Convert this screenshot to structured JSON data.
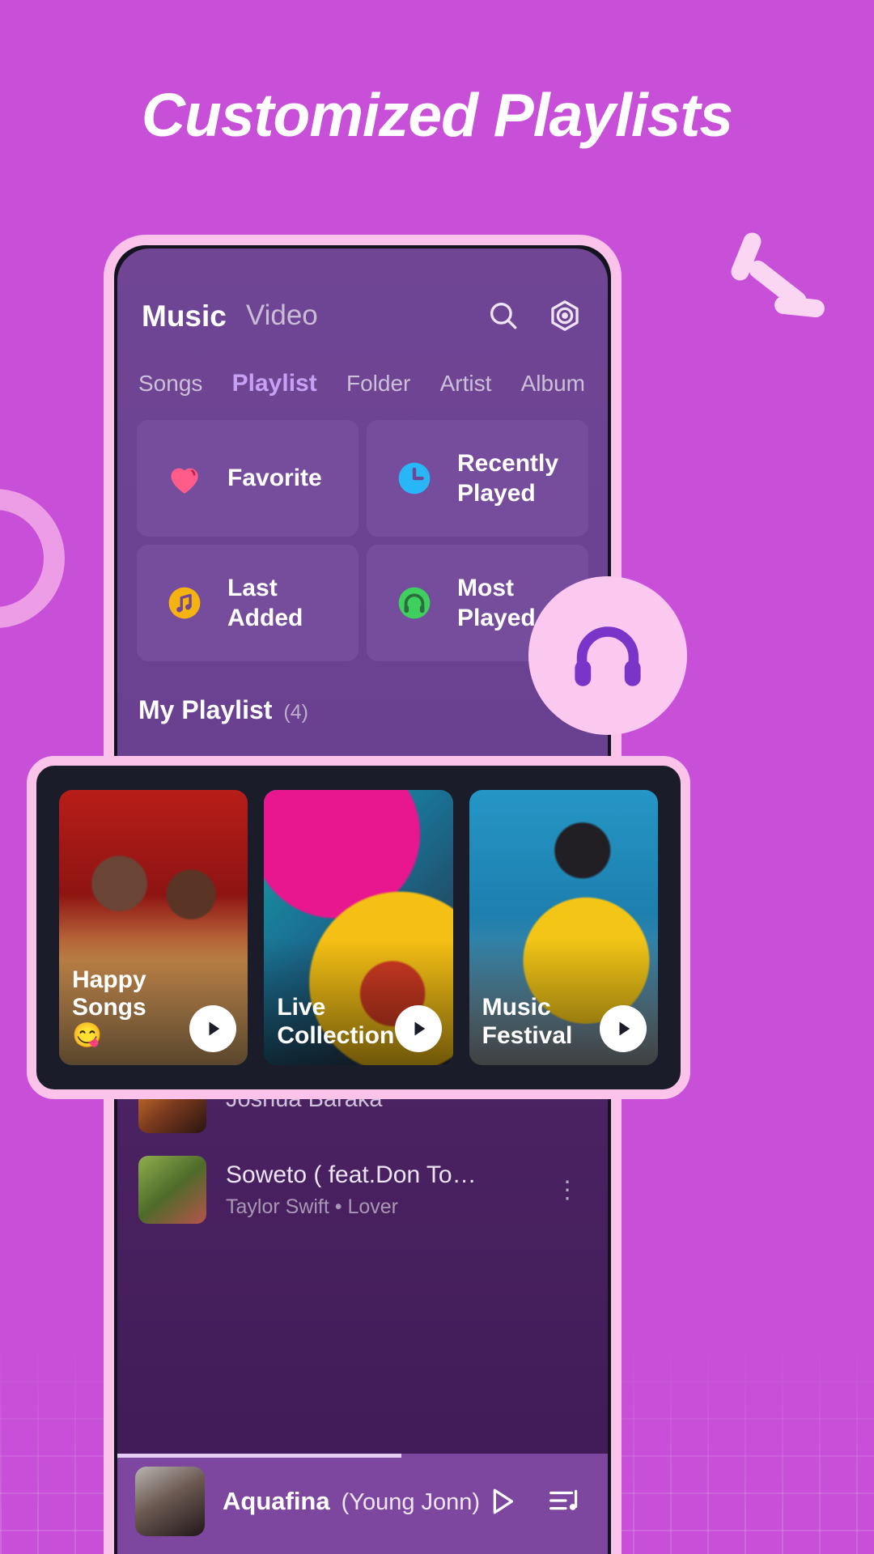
{
  "headline": "Customized Playlists",
  "colors": {
    "background": "#c850d8",
    "phone_frame": "#fbc3ea",
    "screen_top": "#6f4594",
    "screen_bottom": "#3e1a55",
    "accent_tab": "#c6a0f5",
    "favorite_icon": "#ff5c8a",
    "recently_played_icon": "#29b6f6",
    "last_added_icon": "#f5b312",
    "most_played_icon": "#3ecf5f",
    "overlay_panel": "#1b1c2a",
    "now_playing_bar": "#7d479f",
    "headphone_badge": "#fbc9ef"
  },
  "appbar": {
    "mode_music": "Music",
    "mode_video": "Video",
    "search_icon": "search-icon",
    "settings_icon": "settings-hexagon-icon"
  },
  "tabs": [
    {
      "label": "Songs",
      "active": false
    },
    {
      "label": "Playlist",
      "active": true
    },
    {
      "label": "Folder",
      "active": false
    },
    {
      "label": "Artist",
      "active": false
    },
    {
      "label": "Album",
      "active": false
    }
  ],
  "quick_cards": [
    {
      "label": "Favorite",
      "icon": "heart-icon",
      "color": "#ff5c8a"
    },
    {
      "label": "Recently Played",
      "icon": "clock-icon",
      "color": "#29b6f6"
    },
    {
      "label": "Last Added",
      "icon": "music-note-circle-icon",
      "color": "#f5b312"
    },
    {
      "label": "Most Played",
      "icon": "headphones-circle-icon",
      "color": "#3ecf5f"
    }
  ],
  "my_playlist": {
    "title": "My Playlist",
    "count": "(4)"
  },
  "playlist_cards": [
    {
      "title": "Happy Songs 😋",
      "play_icon": "play-icon"
    },
    {
      "title": "Live Collection",
      "play_icon": "play-icon"
    },
    {
      "title": "Music Festival",
      "play_icon": "play-icon"
    }
  ],
  "song_list": [
    {
      "title": "",
      "subtitle": "Joshua Baraka",
      "more_icon": "more-vertical-icon"
    },
    {
      "title": "Soweto ( feat.Don To…",
      "subtitle": "Taylor Swift • Lover",
      "more_icon": "more-vertical-icon"
    }
  ],
  "now_playing": {
    "title": "Aquafina",
    "artist": "(Young Jonn)",
    "play_icon": "play-outline-icon",
    "queue_icon": "playlist-queue-icon"
  },
  "decor": {
    "headphone_badge_icon": "headphones-icon",
    "ring": "circle-ring-decoration",
    "sparkles": "sparkle-lines-decoration"
  }
}
